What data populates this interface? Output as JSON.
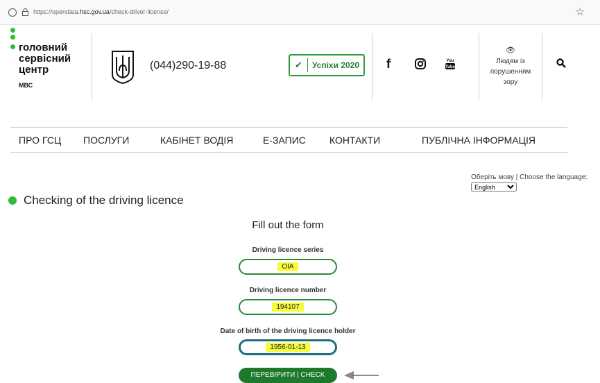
{
  "browser": {
    "url_prefix": "https://opendata.",
    "url_domain": "hsc.gov.ua",
    "url_path": "/check-driver-license/"
  },
  "header": {
    "logo_lines": [
      "головний",
      "сервісний",
      "центр"
    ],
    "logo_sub": "МВС",
    "phone": "(044)290-19-88",
    "success_label": "Успіхи 2020",
    "accessibility_lines": [
      "Людям із",
      "порушенням",
      "зору"
    ]
  },
  "nav": {
    "items": [
      "ПРО ГСЦ",
      "ПОСЛУГИ",
      "КАБІНЕТ ВОДІЯ",
      "Е-ЗАПИС",
      "КОНТАКТИ",
      "ПУБЛІЧНА ІНФОРМАЦІЯ"
    ]
  },
  "language": {
    "prompt": "Оберіть мову | Choose the language:",
    "selected": "English"
  },
  "page": {
    "heading": "Checking of the driving licence",
    "form_title": "Fill out the form"
  },
  "form": {
    "series_label": "Driving licence series",
    "series_value": "OIA",
    "number_label": "Driving licence number",
    "number_value": "194107",
    "dob_label": "Date of birth of the driving licence holder",
    "dob_value": "1956-01-13",
    "submit_label": "ПЕРЕВІРИТИ | CHECK"
  },
  "colors": {
    "brand_green": "#2dbb3a",
    "button_green": "#1e7a2a",
    "highlight": "#f6fb3c"
  }
}
